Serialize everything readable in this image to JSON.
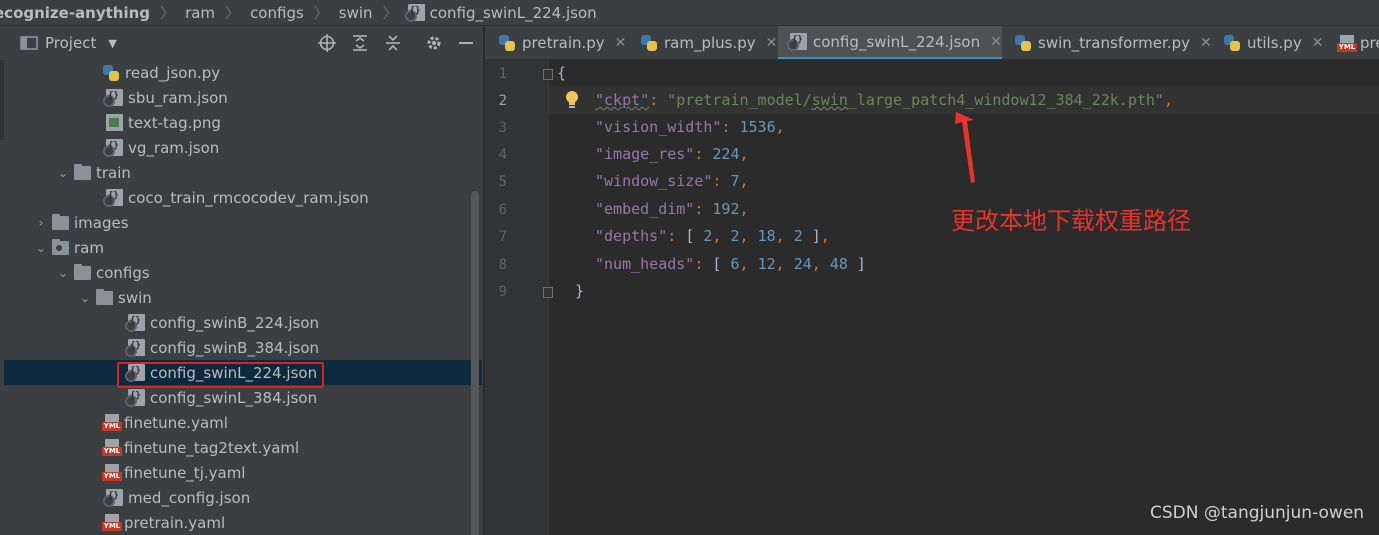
{
  "breadcrumb": {
    "items": [
      "ecognize-anything",
      "ram",
      "configs",
      "swin",
      "config_swinL_224.json"
    ]
  },
  "project": {
    "title": "Project",
    "tree": [
      {
        "label": "read_json.py",
        "icon": "python-file-icon"
      },
      {
        "label": "sbu_ram.json",
        "icon": "json-file-icon"
      },
      {
        "label": "text-tag.png",
        "icon": "image-file-icon"
      },
      {
        "label": "vg_ram.json",
        "icon": "json-file-icon"
      },
      {
        "label": "train",
        "icon": "folder-icon",
        "expanded": true
      },
      {
        "label": "coco_train_rmcocodev_ram.json",
        "icon": "json-file-icon"
      },
      {
        "label": "images",
        "icon": "folder-icon",
        "expanded": false
      },
      {
        "label": "ram",
        "icon": "package-folder-icon",
        "expanded": true
      },
      {
        "label": "configs",
        "icon": "folder-icon",
        "expanded": true
      },
      {
        "label": "swin",
        "icon": "folder-icon",
        "expanded": true
      },
      {
        "label": "config_swinB_224.json",
        "icon": "json-file-icon"
      },
      {
        "label": "config_swinB_384.json",
        "icon": "json-file-icon"
      },
      {
        "label": "config_swinL_224.json",
        "icon": "json-file-icon",
        "selected": true
      },
      {
        "label": "config_swinL_384.json",
        "icon": "json-file-icon"
      },
      {
        "label": "finetune.yaml",
        "icon": "yaml-file-icon"
      },
      {
        "label": "finetune_tag2text.yaml",
        "icon": "yaml-file-icon"
      },
      {
        "label": "finetune_tj.yaml",
        "icon": "yaml-file-icon"
      },
      {
        "label": "med_config.json",
        "icon": "json-file-icon"
      },
      {
        "label": "pretrain.yaml",
        "icon": "yaml-file-icon"
      }
    ]
  },
  "tabs": [
    {
      "label": "pretrain.py",
      "icon": "python-file-icon",
      "active": false
    },
    {
      "label": "ram_plus.py",
      "icon": "python-file-icon",
      "active": false
    },
    {
      "label": "config_swinL_224.json",
      "icon": "json-file-icon",
      "active": true
    },
    {
      "label": "swin_transformer.py",
      "icon": "python-file-icon",
      "active": false
    },
    {
      "label": "utils.py",
      "icon": "python-file-icon",
      "active": false
    },
    {
      "label": "pre",
      "icon": "yaml-file-icon",
      "active": false
    }
  ],
  "editor": {
    "line_numbers": [
      "1",
      "2",
      "3",
      "4",
      "5",
      "6",
      "7",
      "8",
      "9"
    ],
    "current_line": 2,
    "code": {
      "l1": "{",
      "ckpt_key": "\"ckpt\"",
      "ckpt_val_a": "\"pretrain_model/",
      "ckpt_val_b": "swin",
      "ckpt_val_c": "_large_patch4_window12_384_22k.pth\"",
      "vision_width_key": "\"vision_width\"",
      "vision_width_val": "1536",
      "image_res_key": "\"image_res\"",
      "image_res_val": "224",
      "window_size_key": "\"window_size\"",
      "window_size_val": "7",
      "embed_dim_key": "\"embed_dim\"",
      "embed_dim_val": "192",
      "depths_key": "\"depths\"",
      "depths_vals": [
        "2",
        "2",
        "18",
        "2"
      ],
      "num_heads_key": "\"num_heads\"",
      "num_heads_vals": [
        "6",
        "12",
        "24",
        "48"
      ],
      "l9": "}"
    }
  },
  "annotation": {
    "text": "更改本地下载权重路径",
    "color": "#e8322a"
  },
  "watermark": "CSDN @tangjunjun-owen",
  "colors": {
    "key": "#9876aa",
    "string": "#6a8759",
    "number": "#6897bb",
    "punctuation": "#cc7832",
    "selection": "#0d293e",
    "highlight_box": "#e02020"
  }
}
